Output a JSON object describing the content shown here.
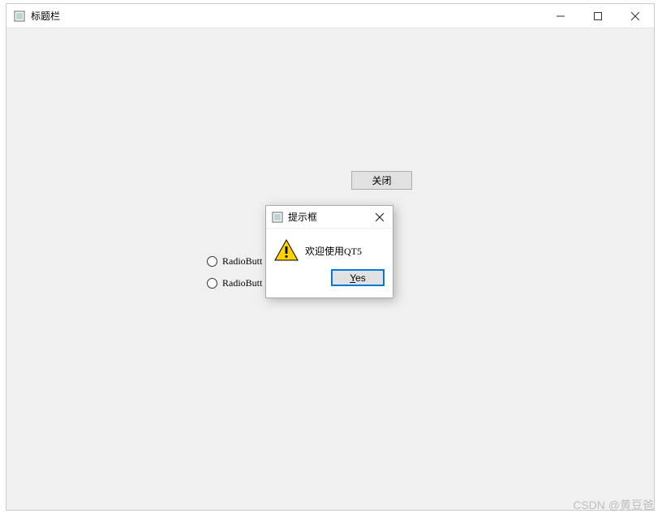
{
  "main_window": {
    "title": "标题栏",
    "close_button_label": "关闭",
    "radio_items": [
      {
        "label": "RadioButt"
      },
      {
        "label": "RadioButt"
      }
    ]
  },
  "dialog": {
    "title": "提示框",
    "icon": "warning",
    "message": "欢迎使用QT5",
    "yes_label": "Yes",
    "yes_mnemonic": "Y"
  },
  "watermark": "CSDN @黄豆爸"
}
